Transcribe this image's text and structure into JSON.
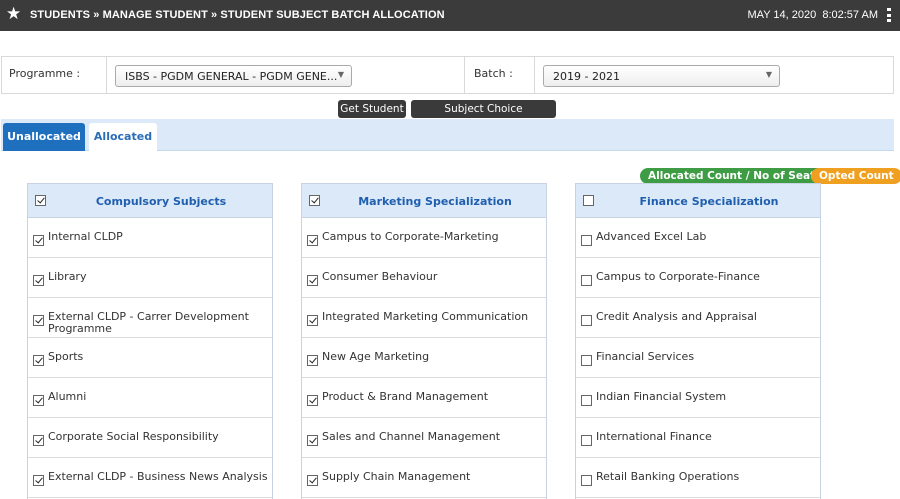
{
  "header": {
    "breadcrumb": "STUDENTS » MANAGE STUDENT » STUDENT SUBJECT BATCH ALLOCATION",
    "date": "MAY 14, 2020",
    "time": "8:02:57 AM"
  },
  "filters": {
    "programme_label": "Programme :",
    "programme_value": "ISBS - PGDM GENERAL - PGDM GENE...",
    "batch_label": "Batch :",
    "batch_value": "2019 - 2021"
  },
  "actions": {
    "get_student": "Get Student",
    "subject_choice_config": "Subject Choice Configuration"
  },
  "tabs": {
    "unallocated": "Unallocated",
    "allocated": "Allocated"
  },
  "legend": {
    "allocated_count": "Allocated Count / No of Seats",
    "opted_count": "Opted Count",
    "green": "#3e9c45",
    "orange": "#f0a020"
  },
  "panels": [
    {
      "title": "Compulsory Subjects",
      "all_checked": true,
      "items": [
        {
          "label": "Internal CLDP",
          "checked": true
        },
        {
          "label": "Library",
          "checked": true
        },
        {
          "label": "External CLDP - Carrer Development Programme",
          "checked": true
        },
        {
          "label": "Sports",
          "checked": true
        },
        {
          "label": "Alumni",
          "checked": true
        },
        {
          "label": "Corporate Social Responsibility",
          "checked": true
        },
        {
          "label": "External CLDP - Business News Analysis",
          "checked": true
        }
      ]
    },
    {
      "title": "Marketing Specialization",
      "all_checked": true,
      "items": [
        {
          "label": "Campus to Corporate-Marketing",
          "checked": true
        },
        {
          "label": "Consumer Behaviour",
          "checked": true
        },
        {
          "label": "Integrated Marketing Communication",
          "checked": true
        },
        {
          "label": "New Age Marketing",
          "checked": true
        },
        {
          "label": "Product & Brand Management",
          "checked": true
        },
        {
          "label": "Sales and Channel Management",
          "checked": true
        },
        {
          "label": "Supply Chain Management",
          "checked": true
        }
      ]
    },
    {
      "title": "Finance Specialization",
      "all_checked": false,
      "items": [
        {
          "label": "Advanced Excel Lab",
          "checked": false
        },
        {
          "label": "Campus to Corporate-Finance",
          "checked": false
        },
        {
          "label": "Credit Analysis and Appraisal",
          "checked": false
        },
        {
          "label": "Financial Services",
          "checked": false
        },
        {
          "label": "Indian Financial System",
          "checked": false
        },
        {
          "label": "International Finance",
          "checked": false
        },
        {
          "label": "Retail Banking Operations",
          "checked": false
        }
      ]
    }
  ]
}
